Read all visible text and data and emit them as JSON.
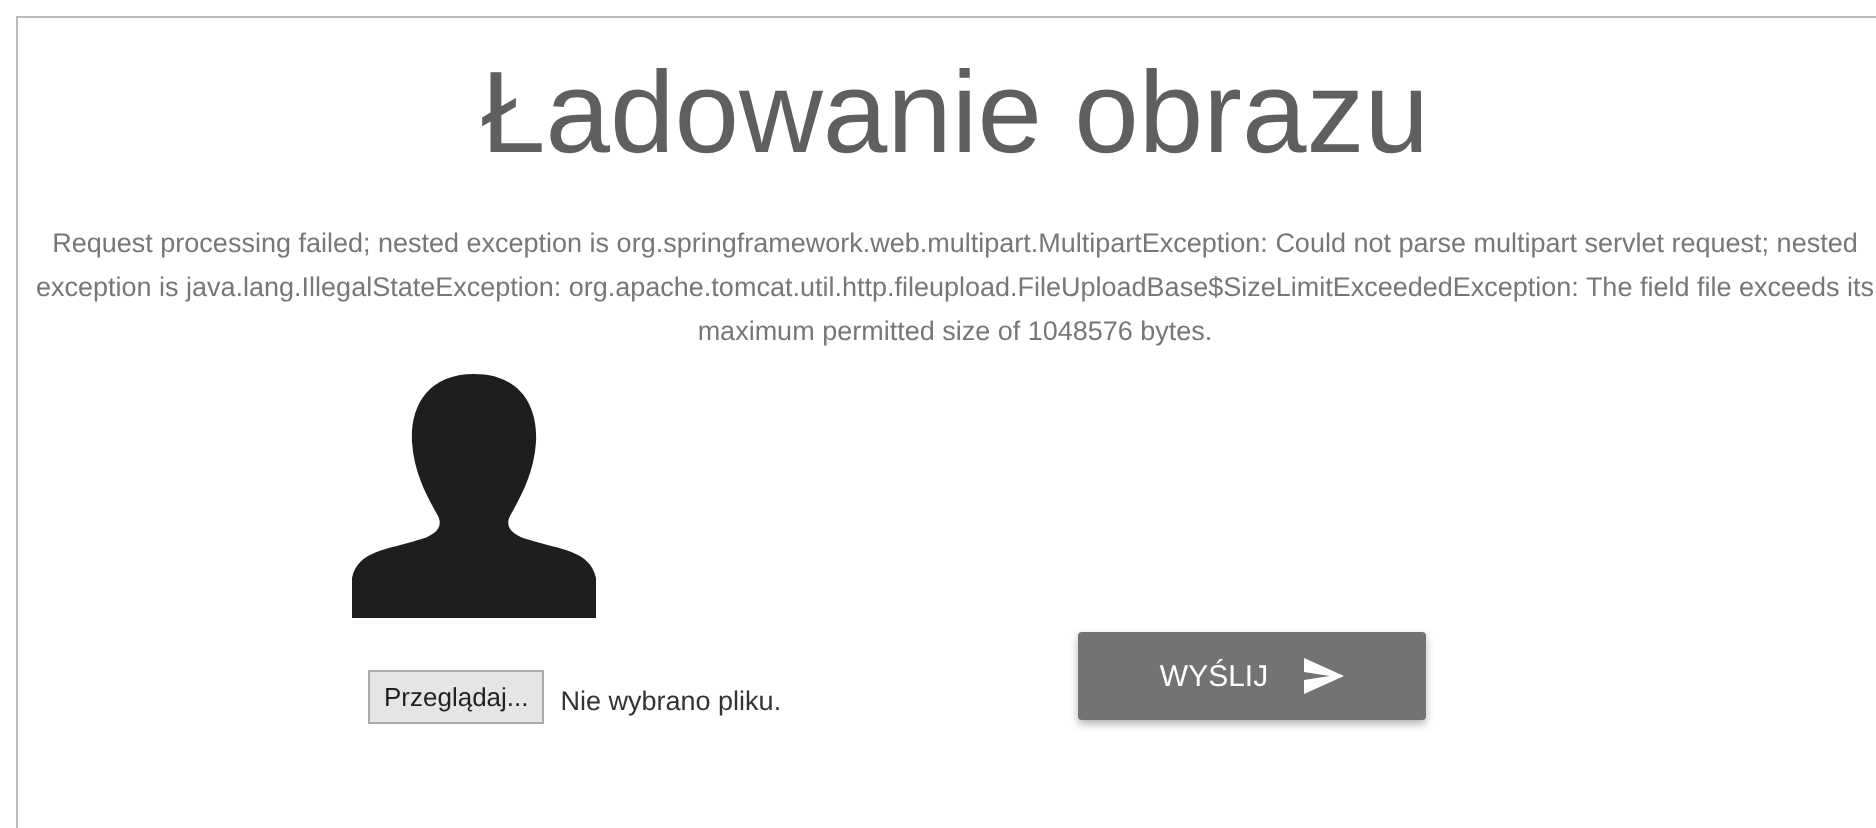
{
  "title": "Ładowanie obrazu",
  "error_message": "Request processing failed; nested exception is org.springframework.web.multipart.MultipartException: Could not parse multipart servlet request; nested exception is java.lang.IllegalStateException: org.apache.tomcat.util.http.fileupload.FileUploadBase$SizeLimitExceededException: The field file exceeds its maximum permitted size of 1048576 bytes.",
  "file_input": {
    "button": "Przeglądaj...",
    "status": "Nie wybrano pliku."
  },
  "submit_button": {
    "label": "WYŚLIJ"
  }
}
